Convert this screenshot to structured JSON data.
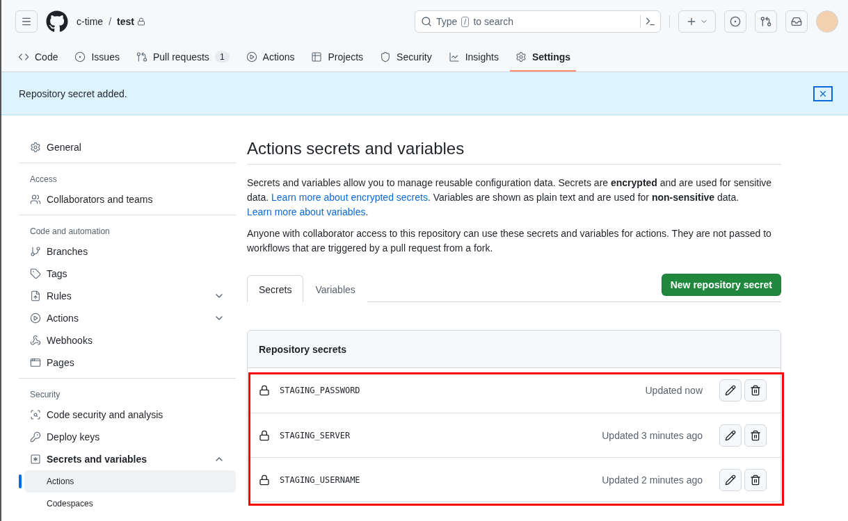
{
  "header": {
    "owner": "c-time",
    "separator": "/",
    "repo": "test",
    "private": true,
    "search": {
      "text_before": "Type",
      "key": "/",
      "text_after": "to search"
    }
  },
  "repo_nav": [
    {
      "label": "Code",
      "selected": false
    },
    {
      "label": "Issues",
      "selected": false
    },
    {
      "label": "Pull requests",
      "counter": "1",
      "selected": false
    },
    {
      "label": "Actions",
      "selected": false
    },
    {
      "label": "Projects",
      "selected": false
    },
    {
      "label": "Security",
      "selected": false
    },
    {
      "label": "Insights",
      "selected": false
    },
    {
      "label": "Settings",
      "selected": true
    }
  ],
  "flash": {
    "message": "Repository secret added."
  },
  "sidebar": [
    {
      "items": [
        {
          "label": "General",
          "selected": false
        }
      ]
    },
    {
      "heading": "Access",
      "items": [
        {
          "label": "Collaborators and teams",
          "selected": false
        }
      ]
    },
    {
      "heading": "Code and automation",
      "items": [
        {
          "label": "Branches",
          "selected": false
        },
        {
          "label": "Tags",
          "selected": false
        },
        {
          "label": "Rules",
          "selected": false,
          "expanded": false
        },
        {
          "label": "Actions",
          "selected": false,
          "expanded": false
        },
        {
          "label": "Webhooks",
          "selected": false
        },
        {
          "label": "Pages",
          "selected": false
        }
      ]
    },
    {
      "heading": "Security",
      "items": [
        {
          "label": "Code security and analysis",
          "selected": false
        },
        {
          "label": "Deploy keys",
          "selected": false
        },
        {
          "label": "Secrets and variables",
          "selected": false,
          "expanded": true,
          "children": [
            {
              "label": "Actions",
              "selected": true
            },
            {
              "label": "Codespaces",
              "selected": false
            }
          ]
        }
      ]
    }
  ],
  "main": {
    "title": "Actions secrets and variables",
    "paragraphs": [
      [
        {
          "kind": "text",
          "text": "Secrets and variables allow you to manage reusable configuration data. Secrets are **encrypted** and are used for sensitive data. "
        },
        {
          "kind": "link",
          "text": "Learn more about encrypted secrets"
        },
        {
          "kind": "text",
          "text": ". Variables are shown as plain text and are used for **non-sensitive** data. "
        },
        {
          "kind": "link",
          "text": "Learn more about variables"
        },
        {
          "kind": "text",
          "text": "."
        }
      ],
      [
        {
          "kind": "text",
          "text": "Anyone with collaborator access to this repository can use these secrets and variables for actions. They are not passed to workflows that are triggered by a pull request from a fork."
        }
      ]
    ],
    "tabs": [
      {
        "label": "Secrets",
        "selected": true
      },
      {
        "label": "Variables",
        "selected": false
      }
    ],
    "new_button": "New repository secret",
    "secrets": {
      "heading": "Repository secrets",
      "highlighted": true,
      "rows": [
        {
          "name": "STAGING_PASSWORD",
          "updated": "Updated now"
        },
        {
          "name": "STAGING_SERVER",
          "updated": "Updated 3 minutes ago"
        },
        {
          "name": "STAGING_USERNAME",
          "updated": "Updated 2 minutes ago"
        }
      ]
    }
  }
}
